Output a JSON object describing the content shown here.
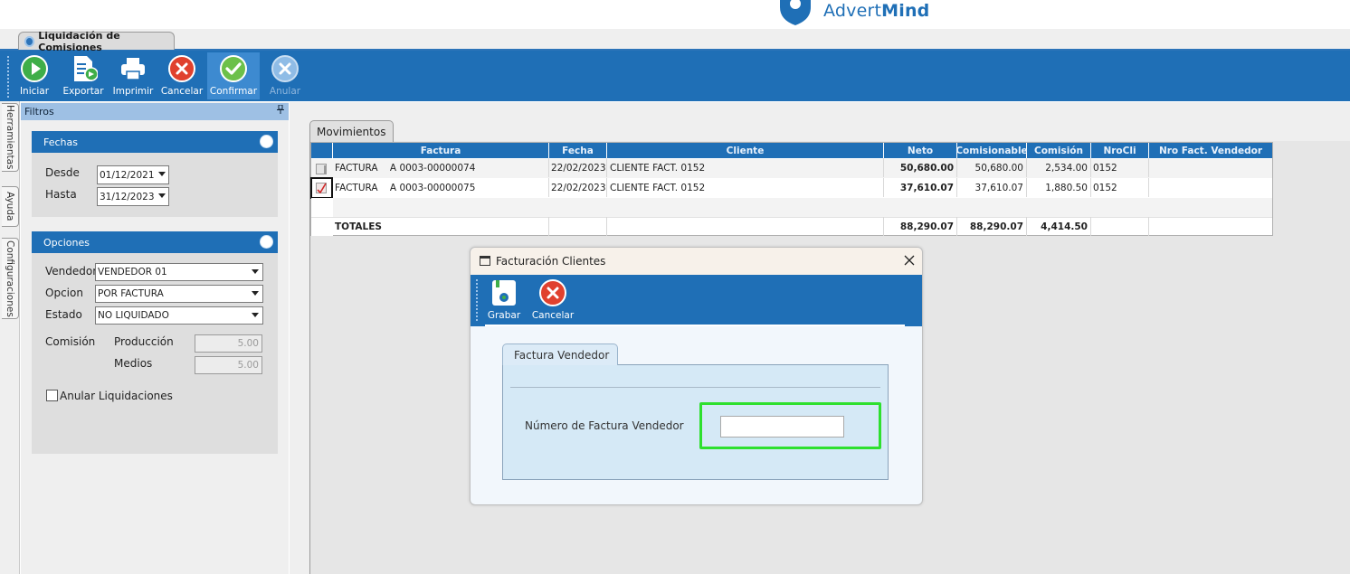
{
  "brand": {
    "name_regular": "Advert",
    "name_bold": "Mind",
    "color": "#1f6fb6"
  },
  "window_tab": {
    "label": "Liquidación de Comisiones"
  },
  "toolbar": {
    "buttons": [
      {
        "label": "Iniciar",
        "icon": "play-icon",
        "state": "normal"
      },
      {
        "label": "Exportar",
        "icon": "export-icon",
        "state": "normal"
      },
      {
        "label": "Imprimir",
        "icon": "printer-icon",
        "state": "normal"
      },
      {
        "label": "Cancelar",
        "icon": "cancel-icon",
        "state": "normal"
      },
      {
        "label": "Confirmar",
        "icon": "check-icon",
        "state": "active"
      },
      {
        "label": "Anular",
        "icon": "void-icon",
        "state": "disabled"
      }
    ]
  },
  "side_tabs": [
    "Herramientas",
    "Ayuda",
    "Configuraciones"
  ],
  "filters": {
    "title": "Filtros",
    "fechas": {
      "title": "Fechas",
      "desde_label": "Desde",
      "desde_value": "01/12/2021",
      "hasta_label": "Hasta",
      "hasta_value": "31/12/2023"
    },
    "opciones": {
      "title": "Opciones",
      "vendedor_label": "Vendedor",
      "vendedor_value": "VENDEDOR 01",
      "opcion_label": "Opcion",
      "opcion_value": "POR FACTURA",
      "estado_label": "Estado",
      "estado_value": "NO LIQUIDADO",
      "comision_label": "Comisión",
      "produccion_label": "Producción",
      "produccion_value": "5.00",
      "medios_label": "Medios",
      "medios_value": "5.00",
      "anular_label": "Anular Liquidaciones",
      "anular_checked": false
    }
  },
  "movimientos": {
    "tab_label": "Movimientos",
    "columns": [
      "Factura",
      "Fecha",
      "Cliente",
      "Neto",
      "Comisionable",
      "Comisión",
      "NroCli",
      "Nro Fact. Vendedor"
    ],
    "rows": [
      {
        "tipo": "FACTURA",
        "numero": "A 0003-00000074",
        "fecha": "22/02/2023",
        "cliente": "CLIENTE FACT. 0152",
        "neto": "50,680.00",
        "comisionable": "50,680.00",
        "comision": "2,534.00",
        "nrocli": "0152",
        "nro_fact_vendedor": "",
        "checked": false
      },
      {
        "tipo": "FACTURA",
        "numero": "A 0003-00000075",
        "fecha": "22/02/2023",
        "cliente": "CLIENTE FACT. 0152",
        "neto": "37,610.07",
        "comisionable": "37,610.07",
        "comision": "1,880.50",
        "nrocli": "0152",
        "nro_fact_vendedor": "",
        "checked": true
      }
    ],
    "totals": {
      "label": "TOTALES",
      "neto": "88,290.07",
      "comisionable": "88,290.07",
      "comision": "4,414.50"
    }
  },
  "dialog": {
    "title": "Facturación Clientes",
    "buttons": [
      {
        "label": "Grabar",
        "icon": "save-icon"
      },
      {
        "label": "Cancelar",
        "icon": "cancel-icon"
      }
    ],
    "tab_label": "Factura Vendedor",
    "field_label": "Número de Factura Vendedor",
    "field_value": "",
    "highlight_color": "#2ee02e"
  }
}
